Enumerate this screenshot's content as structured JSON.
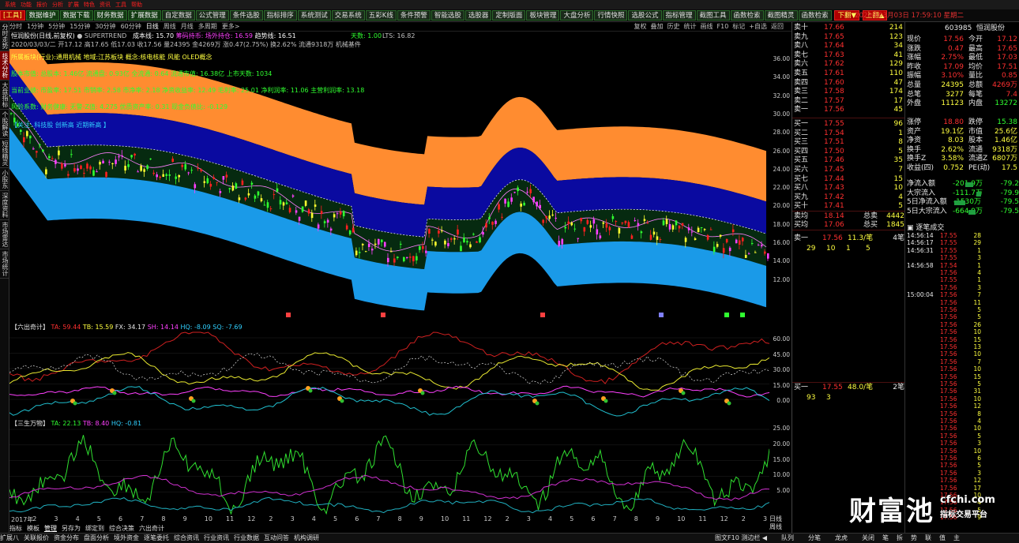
{
  "top_menu": [
    "系统",
    "功能",
    "报价",
    "分析",
    "扩展",
    "特色",
    "资讯",
    "工具",
    "帮助"
  ],
  "toolbar": {
    "items": [
      "[工具]",
      "数据维护",
      "数据下载",
      "财务数据",
      "扩展数据",
      "自定数据",
      "公式管理",
      "条件选股",
      "指标排序",
      "系统测试",
      "交易系统",
      "五彩K线",
      "条件预警",
      "智能选股",
      "选股器",
      "定制版面",
      "板块管理",
      "大盘分析",
      "行情快照",
      "选股公式",
      "指标管理",
      "截图工具",
      "函数检索",
      "截图精灵",
      "函数检索"
    ],
    "btn_down": "下翻▼",
    "btn_up": "上翻▲",
    "datetime": "2020年03月03日 17:59:10 星期二"
  },
  "sidebar": [
    "分时走势",
    "技术分析",
    "大盘指标",
    "个股解读",
    "短线精灵",
    "小股东",
    "深度资料",
    "市场雷达",
    "市场统计"
  ],
  "chart_top": {
    "tabs": [
      "分时",
      "1分钟",
      "5分钟",
      "15分钟",
      "30分钟",
      "60分钟",
      "日线",
      "周线",
      "月线",
      "多周期",
      "更多>"
    ],
    "active": "日线",
    "right": [
      "复权",
      "叠加",
      "历史",
      "统计",
      "画线",
      "F10",
      "标记",
      "+自选",
      "返回"
    ]
  },
  "info": {
    "name": "恒润股份(日线,前复权)",
    "indicator": "SUPERTREND",
    "stat1": "成本线: 15.70",
    "stat2": "筹码持币: 场外持仓: 16.59",
    "stat3": "趋势线: 16.51",
    "day": "天数: 1.00",
    "lts": "LTS: 16.82",
    "line2": "2020/03/03/二 开17.12 高17.65 低17.03 收17.56 量24395 金4269万 涨0.47(2.75%) 换2.62% 流通9318万 机械基件",
    "yellow": "所属板块(行业):通用机械 地域:江苏板块 概念:核电核能 风能 OLED概念",
    "green1": "股本市值: 总股本: 1.46亿 流通盘: 0.93亿 全流通: 0.64 流通市值: 16.38亿 上市天数: 1034",
    "green2": "当前业绩: 市盈率: 17.51 市销率: 2.58 市净率: 2.18 净资收益率: 12.49 毛利率: 25.01 净利润率: 11.06 主营利润率: 13.18",
    "green3": "风险系数: 财务健康: 无警-Z值: 4.275 优质资产率: 0.31 现金负债比: -0.129",
    "cyan": "【关注: 科技股 创新高 近期新高 】"
  },
  "main_yaxis": [
    "36.00",
    "34.00",
    "32.00",
    "30.00",
    "28.00",
    "26.00",
    "24.00",
    "22.00",
    "20.00",
    "18.00",
    "16.00",
    "14.00",
    "12.00"
  ],
  "panel2": {
    "title": "【六出奇计】",
    "ta": "TA: 59.44",
    "tb": "TB: 15.59",
    "fx": "FX: 34.17",
    "sh": "SH: 14.14",
    "hq": "HQ: -8.09",
    "sq": "SQ: -7.69",
    "yaxis": [
      "60.00",
      "45.00",
      "30.00",
      "15.00",
      "0.00"
    ]
  },
  "panel3": {
    "title": "【三生万物】",
    "ta": "TA: 22.13",
    "tb": "TB: 8.40",
    "hq": "HQ: -0.81",
    "yaxis": [
      "25.00",
      "20.00",
      "15.00",
      "10.00",
      "5.00"
    ]
  },
  "xaxis": [
    "2017年",
    "2",
    "3",
    "4",
    "5",
    "6",
    "7",
    "8",
    "9",
    "10",
    "11",
    "12",
    "2",
    "3",
    "4",
    "5",
    "6",
    "7",
    "8",
    "9",
    "10",
    "11",
    "12",
    "2",
    "3",
    "4",
    "5",
    "6",
    "7",
    "8",
    "9",
    "10",
    "11",
    "12",
    "2",
    "3"
  ],
  "bottom_tabs": [
    "指标",
    "模板",
    "管理",
    "另存为",
    "绑定到",
    "综合决策",
    "六出奇计"
  ],
  "bottom_tabs_active": "管理",
  "bottom_corner": [
    "日线",
    "周线"
  ],
  "bottombar": [
    "扩展八",
    "关联报价",
    "资金分布",
    "盘面分析",
    "境外资金",
    "逐笔委托",
    "综合资讯",
    "行业资讯",
    "行业数据",
    "互动问答",
    "机构调研"
  ],
  "bottombar_right": [
    "图文F10 测边栏 ◀",
    "队列",
    "分笔",
    "龙虎",
    "关闭",
    "笔",
    "拆",
    "势",
    "联",
    "值",
    "主"
  ],
  "stock": {
    "code": "603985",
    "name": "恒润股份"
  },
  "asks": [
    [
      "卖十",
      "17.66",
      "214"
    ],
    [
      "卖九",
      "17.65",
      "123"
    ],
    [
      "卖八",
      "17.64",
      "34"
    ],
    [
      "卖七",
      "17.63",
      "41"
    ],
    [
      "卖六",
      "17.62",
      "129"
    ],
    [
      "卖五",
      "17.61",
      "110"
    ],
    [
      "卖四",
      "17.60",
      "47"
    ],
    [
      "卖三",
      "17.58",
      "174"
    ],
    [
      "卖二",
      "17.57",
      "17"
    ],
    [
      "卖一",
      "17.56",
      "45"
    ]
  ],
  "bids": [
    [
      "买一",
      "17.55",
      "96"
    ],
    [
      "买二",
      "17.54",
      "1"
    ],
    [
      "买三",
      "17.51",
      "8"
    ],
    [
      "买四",
      "17.50",
      "5"
    ],
    [
      "买五",
      "17.46",
      "35"
    ],
    [
      "买六",
      "17.45",
      "7"
    ],
    [
      "买七",
      "17.44",
      "15"
    ],
    [
      "买八",
      "17.43",
      "10"
    ],
    [
      "买九",
      "17.42",
      "4"
    ],
    [
      "买十",
      "17.41",
      "5"
    ]
  ],
  "avg": {
    "sell_label": "卖均",
    "sell_price": "18.14",
    "sell_tag": "总卖",
    "sell_total": "4442",
    "buy_label": "买均",
    "buy_price": "17.06",
    "buy_tag": "总买",
    "buy_total": "1845"
  },
  "quote": [
    [
      "现价",
      "17.56",
      "今开",
      "17.12"
    ],
    [
      "涨跌",
      "0.47",
      "最高",
      "17.65"
    ],
    [
      "涨幅",
      "2.75%",
      "最低",
      "17.03"
    ],
    [
      "昨收",
      "17.09",
      "均价",
      "17.51"
    ],
    [
      "振幅",
      "3.10%",
      "量比",
      "0.85"
    ],
    [
      "总量",
      "24395",
      "总额",
      "4269万"
    ],
    [
      "总笔",
      "3277",
      "每笔",
      "7.4"
    ],
    [
      "外盘",
      "11123",
      "内盘",
      "13272"
    ]
  ],
  "fin": [
    [
      "涨停",
      "18.80",
      "跌停",
      "15.38"
    ],
    [
      "资产",
      "19.1亿",
      "市值",
      "25.6亿"
    ],
    [
      "净资",
      "8.03",
      "股本",
      "1.46亿"
    ],
    [
      "换手",
      "2.62%",
      "流通",
      "9318万"
    ],
    [
      "换手Z",
      "3.58%",
      "流通Z",
      "6807万"
    ],
    [
      "收益(四)",
      "0.752",
      "PE(动)",
      "17.5"
    ]
  ],
  "flow": [
    [
      "净流入额",
      "-201.9万",
      "-79.2"
    ],
    [
      "大宗流入",
      "-111.7万",
      "-79.9"
    ],
    [
      "5日净流入额",
      "-1530万",
      "-79.5"
    ],
    [
      "5日大宗流入",
      "-664.9万",
      "-79.5"
    ]
  ],
  "queue1": {
    "label": "卖一",
    "price": "17.56",
    "vol": "11.3/笔",
    "cnt": "4笔",
    "items": [
      "29",
      "10",
      "1",
      "5"
    ]
  },
  "queue2": {
    "label": "买一",
    "price": "17.55",
    "vol": "48.0/笔",
    "cnt": "2笔",
    "items": [
      "93",
      "3"
    ]
  },
  "trades_header": "逐笔成交",
  "trades": [
    [
      "14:56:14",
      "17.55",
      "28"
    ],
    [
      "14:56:17",
      "17.55",
      "29"
    ],
    [
      "14:56:31",
      "17.55",
      "1"
    ],
    [
      "",
      "17.55",
      "3"
    ],
    [
      "14:56:58",
      "17.54",
      "1"
    ],
    [
      "",
      "17.56",
      "4"
    ],
    [
      "",
      "17.55",
      "1"
    ],
    [
      "",
      "17.56",
      "3"
    ],
    [
      "15:00:04",
      "17.56",
      "7"
    ],
    [
      "",
      "17.56",
      "11"
    ],
    [
      "",
      "17.56",
      "5"
    ],
    [
      "",
      "17.56",
      "5"
    ],
    [
      "",
      "17.56",
      "26"
    ],
    [
      "",
      "17.56",
      "10"
    ],
    [
      "",
      "17.56",
      "15"
    ],
    [
      "",
      "17.56",
      "13"
    ],
    [
      "",
      "17.56",
      "10"
    ],
    [
      "",
      "17.56",
      "7"
    ],
    [
      "",
      "17.56",
      "10"
    ],
    [
      "",
      "17.56",
      "15"
    ],
    [
      "",
      "17.56",
      "5"
    ],
    [
      "",
      "17.56",
      "31"
    ],
    [
      "",
      "17.56",
      "10"
    ],
    [
      "",
      "17.56",
      "12"
    ],
    [
      "",
      "17.56",
      "8"
    ],
    [
      "",
      "17.56",
      "4"
    ],
    [
      "",
      "17.56",
      "10"
    ],
    [
      "",
      "17.56",
      "5"
    ],
    [
      "",
      "17.56",
      "3"
    ],
    [
      "",
      "17.56",
      "10"
    ],
    [
      "",
      "17.56",
      "6"
    ],
    [
      "",
      "17.56",
      "5"
    ],
    [
      "",
      "17.56",
      "3"
    ],
    [
      "",
      "17.56",
      "12"
    ],
    [
      "",
      "17.56",
      "17"
    ],
    [
      "",
      "17.56",
      "10"
    ],
    [
      "",
      "17.56",
      "4"
    ],
    [
      "",
      "17.56",
      "5"
    ],
    [
      "",
      "17.56",
      "9"
    ]
  ],
  "brand": {
    "name": "财富池",
    "domain": "cfchi.com",
    "slogan": "指标交易平台"
  }
}
